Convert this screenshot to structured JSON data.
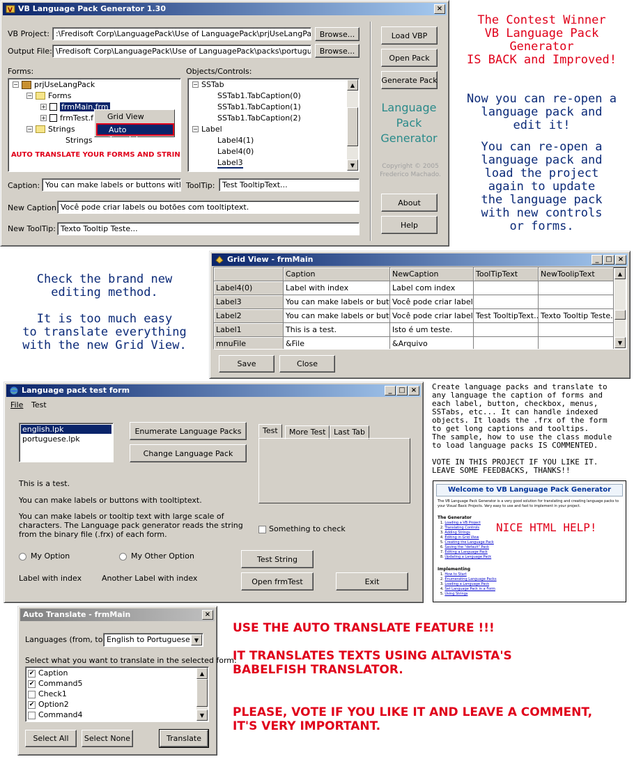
{
  "main_window": {
    "title": "VB Language Pack Generator 1.30",
    "vb_project_label": "VB Project:",
    "vb_project_value": ":\\Fredisoft Corp\\LanguagePack\\Use of LanguagePack\\prjUseLangPack.vbp",
    "output_file_label": "Output File:",
    "output_file_value": "\\Fredisoft Corp\\LanguagePack\\Use of LanguagePack\\packs\\portuguese.lpk",
    "browse1": "Browse...",
    "browse2": "Browse...",
    "forms_label": "Forms:",
    "objects_label": "Objects/Controls:",
    "tree": {
      "root": "prjUseLangPack",
      "forms": "Forms",
      "frmmain": "frmMain.frm",
      "frmtest": "frmTest.f",
      "strings": "Strings",
      "strings_child": "Strings"
    },
    "context_menu": {
      "grid_view": "Grid View",
      "auto_translate": "Auto Translate"
    },
    "auto_banner": "AUTO TRANSLATE YOUR FORMS AND STRINGS",
    "objects": [
      "SSTab",
      "SSTab1.TabCaption(0)",
      "SSTab1.TabCaption(1)",
      "SSTab1.TabCaption(2)",
      "Label",
      "Label4(1)",
      "Label4(0)",
      "Label3"
    ],
    "caption_label": "Caption:",
    "caption_value": "You can make labels or buttons with toolti",
    "tooltip_label": "ToolTip:",
    "tooltip_value": "Test TooltipText...",
    "new_caption_label": "New Caption:",
    "new_caption_value": "Você pode criar labels ou botões com tooltiptext.",
    "new_tooltip_label": "New ToolTip:",
    "new_tooltip_value": "Texto Tooltip Teste...",
    "buttons": {
      "load_vbp": "Load VBP",
      "open_pack": "Open Pack",
      "generate_pack": "Generate Pack",
      "about": "About",
      "help": "Help"
    },
    "logo_text": "Language\nPack\nGenerator",
    "copyright": "Copyright © 2005\nFrederico Machado."
  },
  "promo": {
    "contest": "The Contest Winner\nVB Language Pack\nGenerator\nIS BACK and Improved!",
    "reopen1": "Now you can re-open a\nlanguage pack and\nedit it!",
    "reopen2": "You can re-open a\nlanguage pack and\nload the project\nagain to update\nthe language pack\nwith new controls\nor forms.",
    "editing": "Check the brand new\nediting method.\n\nIt is too much easy\nto translate everything\nwith the new Grid View.",
    "description": "Create language packs and translate to\nany language the caption of forms and\neach label, button, checkbox, menus,\nSSTabs, etc... It can handle indexed\nobjects. It loads the .frx of the form\nto get long captions and tooltips.\nThe sample, how to use the class module\nto load language packs IS COMMENTED.\n\nVOTE IN THIS PROJECT IF YOU LIKE IT.\nLEAVE SOME FEEDBACKS, THANKS!!",
    "nice_help": "NICE HTML HELP!",
    "auto_feature": "USE THE AUTO TRANSLATE FEATURE !!!",
    "babelfish": "IT TRANSLATES TEXTS USING ALTAVISTA'S\nBABELFISH TRANSLATOR.",
    "vote": "PLEASE, VOTE IF YOU LIKE IT AND LEAVE A COMMENT,\nIT'S VERY IMPORTANT."
  },
  "grid_window": {
    "title": "Grid View - frmMain",
    "headers": [
      "",
      "Caption",
      "NewCaption",
      "ToolTipText",
      "NewToolipText"
    ],
    "rows": [
      [
        "Label4(0)",
        "Label with index",
        "Label com index",
        "",
        ""
      ],
      [
        "Label3",
        "You can make labels or buttons with toolti",
        "Você pode criar labels o",
        "",
        ""
      ],
      [
        "Label2",
        "You can make labels or buttons",
        "Você pode criar labels o",
        "Test TooltipText...",
        "Texto Tooltip Teste..."
      ],
      [
        "Label1",
        "This is a test.",
        "Isto é um teste.",
        "",
        ""
      ],
      [
        "mnuFile",
        "&File",
        "&Arquivo",
        "",
        ""
      ]
    ],
    "save": "Save",
    "close": "Close"
  },
  "test_window": {
    "title": "Language pack test form",
    "menu": [
      "File",
      "Test"
    ],
    "list": [
      "english.lpk",
      "portuguese.lpk"
    ],
    "enumerate": "Enumerate Language Packs",
    "change": "Change Language Pack",
    "tabs": [
      "Test",
      "More Test",
      "Last Tab"
    ],
    "this_is_test": "This is a test.",
    "tooltiptext": "You can make labels or buttons with tooltiptext.",
    "long_text": "You can make labels or tooltip text with large scale of characters. The Language pack generator reads the string from the binary file (.frx) of each form.",
    "something": "Something to check",
    "my_option": "My Option",
    "my_other_option": "My Other Option",
    "test_string": "Test String",
    "label_index": "Label with index",
    "another_label": "Another Label with index",
    "open_frmtest": "Open frmTest",
    "exit": "Exit"
  },
  "help_window": {
    "title": "Welcome to VB Language Pack Generator",
    "intro": "The VB Language Pack Generator is a very good solution for translating and creating language packs to your Visual Basic Projects. Very easy to use and fast to implement in your project.",
    "generator_heading": "The Generator",
    "generator_items": [
      "Loading a VB Project",
      "Translating Controls",
      "Adding Strings",
      "Editing in Grid View",
      "Creating the Language Pack",
      "Saving the \"default\" Pack",
      "Editing a Language Pack",
      "Updating a Language Pack"
    ],
    "impl_heading": "Implementing",
    "impl_items": [
      "How to Start",
      "Enumerating Language Packs",
      "Loading a Language Pack",
      "Set Language Pack in a Form",
      "Using Strings"
    ]
  },
  "auto_window": {
    "title": "Auto Translate - frmMain",
    "languages_label": "Languages (from, to):",
    "languages_value": "English to Portuguese",
    "select_label": "Select what you want to translate in the selected form:",
    "items": [
      {
        "label": "Caption",
        "checked": true
      },
      {
        "label": "Command5",
        "checked": true
      },
      {
        "label": "Check1",
        "checked": false
      },
      {
        "label": "Option2",
        "checked": true
      },
      {
        "label": "Command4",
        "checked": false
      }
    ],
    "select_all": "Select All",
    "select_none": "Select None",
    "translate": "Translate"
  }
}
